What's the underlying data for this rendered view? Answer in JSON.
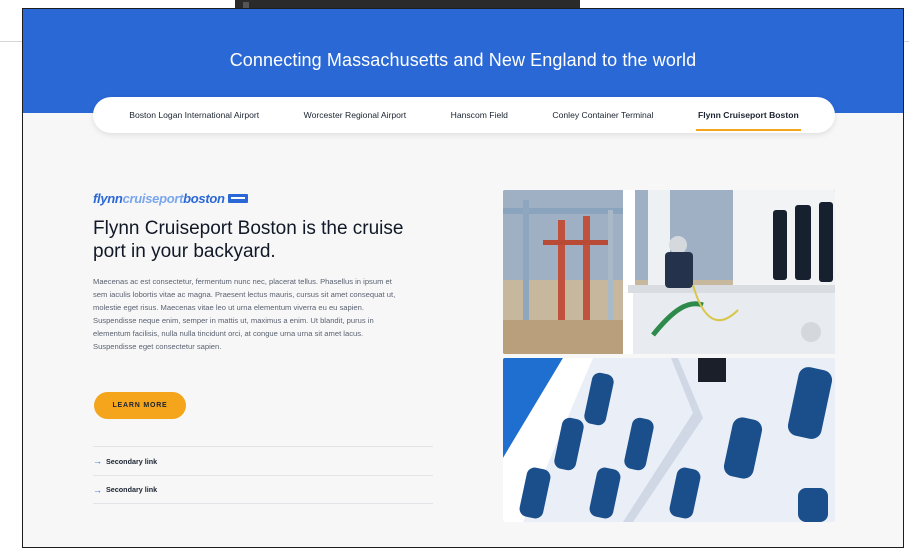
{
  "hero": {
    "title": "Connecting Massachusetts and New England to the world"
  },
  "tabs": [
    {
      "label": "Boston Logan International Airport",
      "active": false
    },
    {
      "label": "Worcester Regional Airport",
      "active": false
    },
    {
      "label": "Hanscom Field",
      "active": false
    },
    {
      "label": "Conley Container Terminal",
      "active": false
    },
    {
      "label": "Flynn Cruiseport Boston",
      "active": true
    }
  ],
  "section": {
    "logo": {
      "part1": "flynn",
      "part2": "cruiseport",
      "part3": "boston"
    },
    "heading": "Flynn Cruiseport Boston is the cruise port in your backyard.",
    "body": "Maecenas ac est consectetur, fermentum nunc nec, placerat tellus. Phasellus in ipsum et sem iaculis lobortis vitae ac magna. Praesent lectus mauris, cursus sit amet consequat ut, molestie eget risus. Maecenas vitae leo ut urna elementum viverra eu eu sapien. Suspendisse neque enim, semper in mattis ut, maximus a enim. Ut blandit, purus in elementum facilisis, nulla nulla tincidunt orci, at congue urna urna sit amet lacus. Suspendisse eget consectetur sapien.",
    "button_label": "LEARN MORE",
    "links": [
      {
        "label": "Secondary link"
      },
      {
        "label": "Secondary link"
      }
    ]
  },
  "colors": {
    "brand_blue": "#2a68d6",
    "accent_orange": "#f4a51c",
    "text_dark": "#111826"
  },
  "icons": {
    "link_arrow": "arrow-right-icon"
  }
}
